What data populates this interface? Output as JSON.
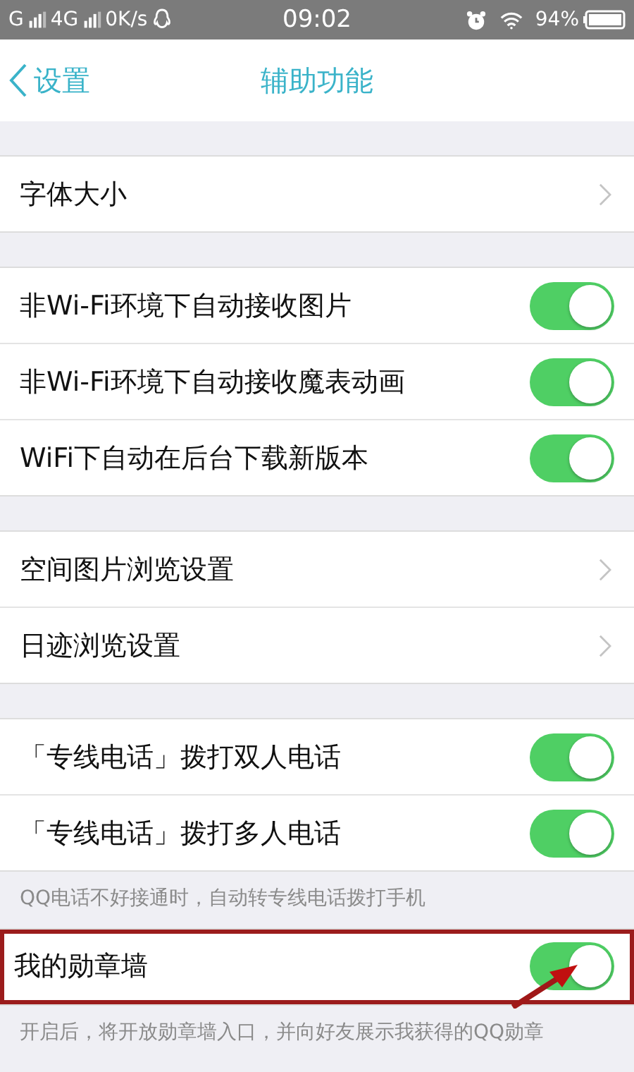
{
  "status_bar": {
    "network_1": "G",
    "network_2": "4G",
    "speed": "0K/s",
    "time": "09:02",
    "battery": "94%"
  },
  "nav": {
    "back": "设置",
    "title": "辅助功能"
  },
  "sections": [
    {
      "rows": [
        {
          "kind": "link",
          "label": "字体大小"
        }
      ]
    },
    {
      "rows": [
        {
          "kind": "toggle",
          "label": "非Wi-Fi环境下自动接收图片",
          "on": true
        },
        {
          "kind": "toggle",
          "label": "非Wi-Fi环境下自动接收魔表动画",
          "on": true
        },
        {
          "kind": "toggle",
          "label": "WiFi下自动在后台下载新版本",
          "on": true
        }
      ]
    },
    {
      "rows": [
        {
          "kind": "link",
          "label": "空间图片浏览设置"
        },
        {
          "kind": "link",
          "label": "日迹浏览设置"
        }
      ]
    },
    {
      "rows": [
        {
          "kind": "toggle",
          "label": "「专线电话」拨打双人电话",
          "on": true
        },
        {
          "kind": "toggle",
          "label": "「专线电话」拨打多人电话",
          "on": true
        }
      ],
      "footer": "QQ电话不好接通时，自动转专线电话拨打手机"
    },
    {
      "rows": [
        {
          "kind": "toggle",
          "label": "我的勋章墙",
          "on": true,
          "highlighted": true
        }
      ],
      "footer": "开启后，将开放勋章墙入口，并向好友展示我获得的QQ勋章"
    }
  ]
}
